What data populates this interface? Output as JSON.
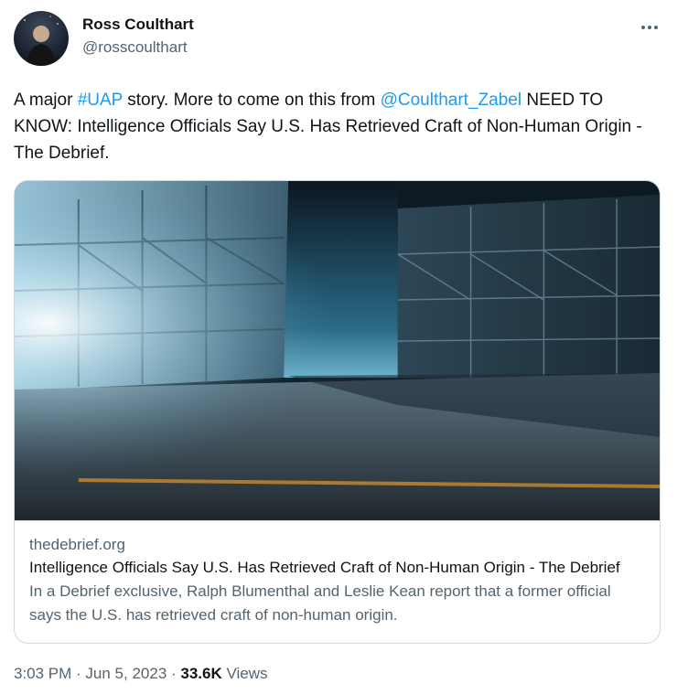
{
  "author": {
    "name": "Ross Coulthart",
    "handle": "@rosscoulthart"
  },
  "tweet": {
    "text_1": "A major ",
    "hashtag": "#UAP",
    "text_2": " story. More to come on this from ",
    "mention": "@Coulthart_Zabel",
    "text_3": " NEED TO KNOW: Intelligence Officials Say U.S. Has Retrieved Craft of Non-Human Origin - The Debrief."
  },
  "card": {
    "domain": "thedebrief.org",
    "title": "Intelligence Officials Say U.S. Has Retrieved Craft of Non-Human Origin - The Debrief",
    "description": "In a Debrief exclusive, Ralph Blumenthal and Leslie Kean report that a former official says the U.S. has retrieved craft of non-human origin."
  },
  "meta": {
    "time": "3:03 PM",
    "date": "Jun 5, 2023",
    "views_count": "33.6K",
    "views_label": "Views"
  },
  "icons": {
    "more": "more-options-icon"
  }
}
